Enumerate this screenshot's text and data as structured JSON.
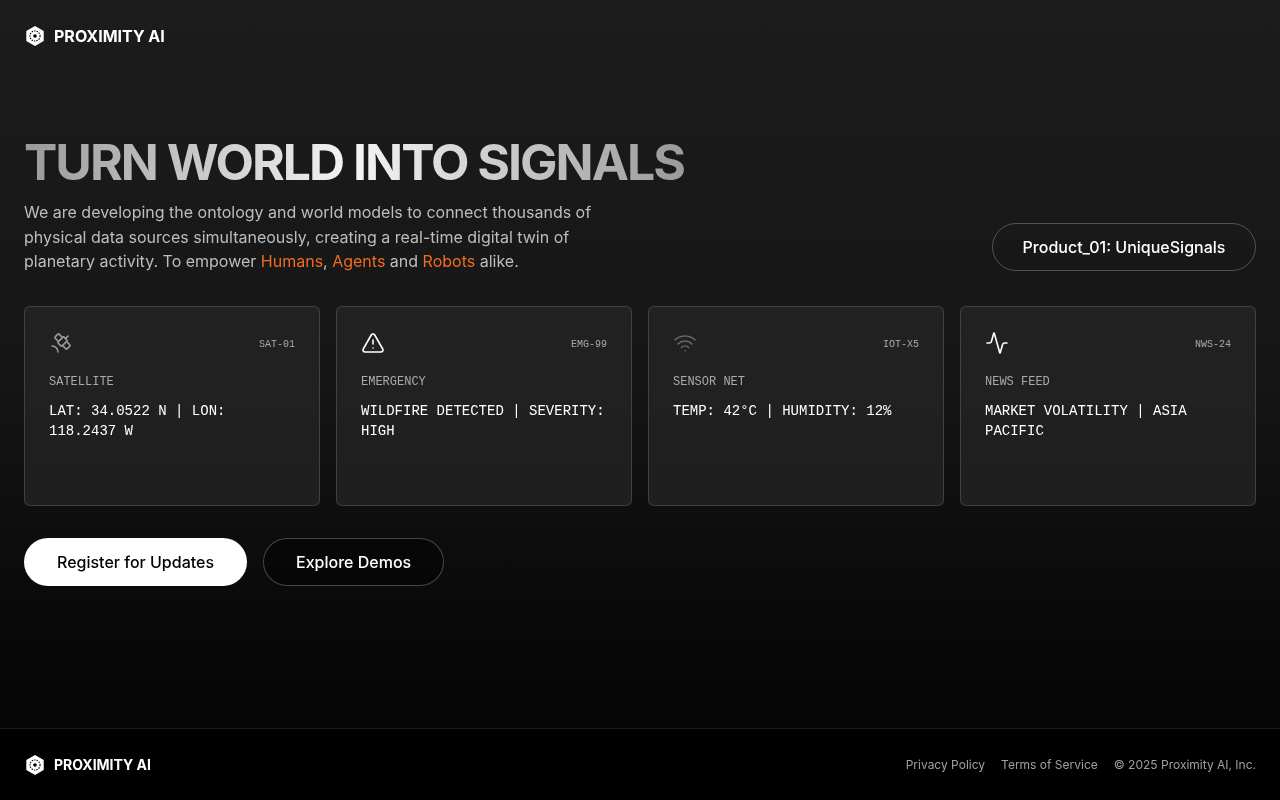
{
  "header": {
    "brand": "PROXIMITY AI"
  },
  "hero": {
    "title": "TURN WORLD INTO SIGNALS",
    "description": [
      {
        "text": "We are developing the ontology and world models to connect thousands of physical data sources simultaneously, creating a real-time digital twin of planetary activity. To empower ",
        "highlight": false
      },
      {
        "text": "Humans",
        "highlight": true
      },
      {
        "text": ", ",
        "highlight": false
      },
      {
        "text": "Agents",
        "highlight": true
      },
      {
        "text": " and ",
        "highlight": false
      },
      {
        "text": "Robots",
        "highlight": true
      },
      {
        "text": " alike.",
        "highlight": false
      }
    ],
    "product_button": "Product_01: UniqueSignals"
  },
  "cards": [
    {
      "kind": "satellite",
      "code": "SAT-01",
      "label": "SATELLITE",
      "value": "LAT: 34.0522 N | LON: 118.2437 W"
    },
    {
      "kind": "emergency",
      "code": "EMG-99",
      "label": "EMERGENCY",
      "value": "WILDFIRE DETECTED | SEVERITY: HIGH"
    },
    {
      "kind": "sensor",
      "code": "IOT-X5",
      "label": "SENSOR NET",
      "value": "TEMP: 42°C | HUMIDITY: 12%"
    },
    {
      "kind": "news",
      "code": "NWS-24",
      "label": "NEWS FEED",
      "value": "MARKET VOLATILITY | ASIA PACIFIC"
    }
  ],
  "buttons": [
    {
      "kind": "primary",
      "label": "Register for Updates"
    },
    {
      "kind": "secondary",
      "label": "Explore Demos"
    }
  ],
  "footer": {
    "brand": "PROXIMITY AI",
    "links": [
      "Privacy Policy",
      "Terms of Service"
    ],
    "copyright": "© 2025 Proximity AI, Inc."
  }
}
